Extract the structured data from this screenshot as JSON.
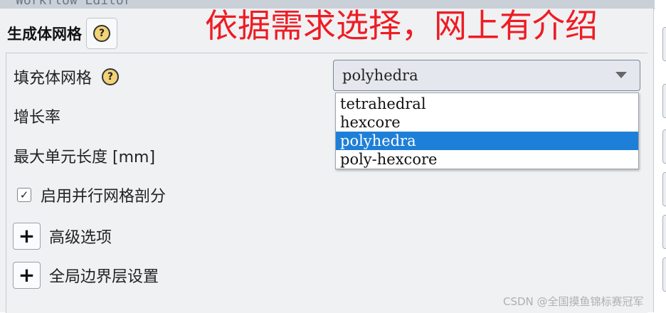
{
  "window": {
    "title": "Workflow Editor"
  },
  "section": {
    "title": "生成体网格",
    "help_label": "?"
  },
  "fields": {
    "fill_mesh": {
      "label": "填充体网格",
      "help_label": "?"
    },
    "growth_rate": {
      "label": "增长率"
    },
    "max_cell_length": {
      "label": "最大单元长度 [mm]"
    }
  },
  "select": {
    "value": "polyhedra",
    "options": [
      "tetrahedral",
      "hexcore",
      "polyhedra",
      "poly-hexcore"
    ],
    "selected_index": 2
  },
  "parallel": {
    "label": "启用并行网格剖分",
    "checked": true,
    "check_glyph": "✓"
  },
  "expanders": {
    "advanced": {
      "symbol": "+",
      "label": "高级选项"
    },
    "boundary": {
      "symbol": "+",
      "label": "全局边界层设置"
    }
  },
  "annotation": {
    "text": "依据需求选择，网上有介绍",
    "color": "#ee1c24"
  },
  "watermark": {
    "text": "CSDN @全国摸鱼锦标赛冠军"
  },
  "colors": {
    "highlight": "#1e7fd8",
    "help_icon": "#f3d278"
  }
}
